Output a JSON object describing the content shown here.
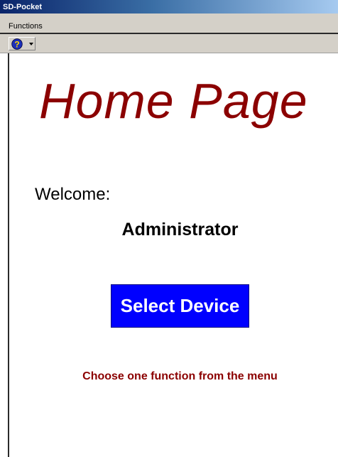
{
  "window": {
    "title": "SD-Pocket"
  },
  "menubar": {
    "items": [
      {
        "label": "Functions"
      }
    ]
  },
  "toolbar": {
    "help_icon": "help-icon",
    "dropdown_icon": "chevron-down-icon"
  },
  "main": {
    "page_title": "Home Page",
    "welcome_label": "Welcome:",
    "username": "Administrator",
    "select_device_label": "Select Device",
    "instruction": "Choose one function from the menu"
  },
  "colors": {
    "title_text": "#8b0000",
    "button_bg": "#0000ff",
    "button_text": "#ffffff",
    "instruction_text": "#8b0000"
  }
}
